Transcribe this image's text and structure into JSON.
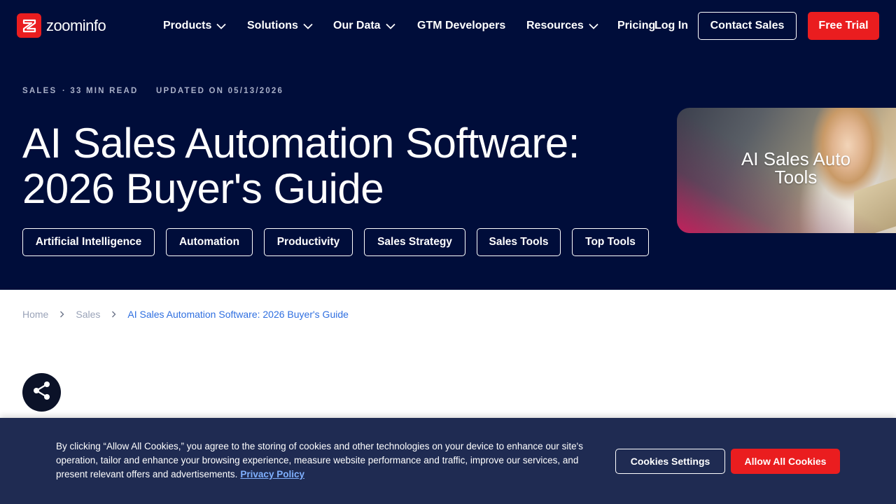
{
  "brand": {
    "name": "zoominfo",
    "accent": "#ea1d1f",
    "header_bg": "#000d3a",
    "link_color": "#2f6fe0"
  },
  "nav": {
    "items": [
      {
        "label": "Products",
        "has_dropdown": true
      },
      {
        "label": "Solutions",
        "has_dropdown": true
      },
      {
        "label": "Our Data",
        "has_dropdown": true
      },
      {
        "label": "GTM Developers",
        "has_dropdown": false
      },
      {
        "label": "Resources",
        "has_dropdown": true
      },
      {
        "label": "Pricing",
        "has_dropdown": false
      },
      {
        "label": "Log In",
        "has_dropdown": false
      }
    ],
    "contact_label": "Contact Sales",
    "trial_label": "Free Trial"
  },
  "article": {
    "category": "SALES",
    "read_time": "· 33 MIN READ",
    "updated": "UPDATED ON 05/13/2026",
    "title": "AI Sales Automation Software: 2026 Buyer's Guide",
    "tags": [
      "Artificial Intelligence",
      "Automation",
      "Productivity",
      "Sales Strategy",
      "Sales Tools",
      "Top Tools"
    ],
    "hero_caption": "AI Sales Auto Tools"
  },
  "breadcrumb": {
    "items": [
      "Home",
      "Sales"
    ],
    "current": "AI Sales Automation Software: 2026 Buyer's Guide"
  },
  "share": {
    "icon": "share-icon"
  },
  "cookie": {
    "text": "By clicking “Allow All Cookies,” you agree to the storing of cookies and other technologies on your device to enhance our site's operation, tailor and enhance your browsing experience, measure website performance and traffic, improve our services, and present relevant offers and advertisements.",
    "link": "Privacy Policy",
    "settings_label": "Cookies Settings",
    "allow_label": "Allow All Cookies"
  }
}
